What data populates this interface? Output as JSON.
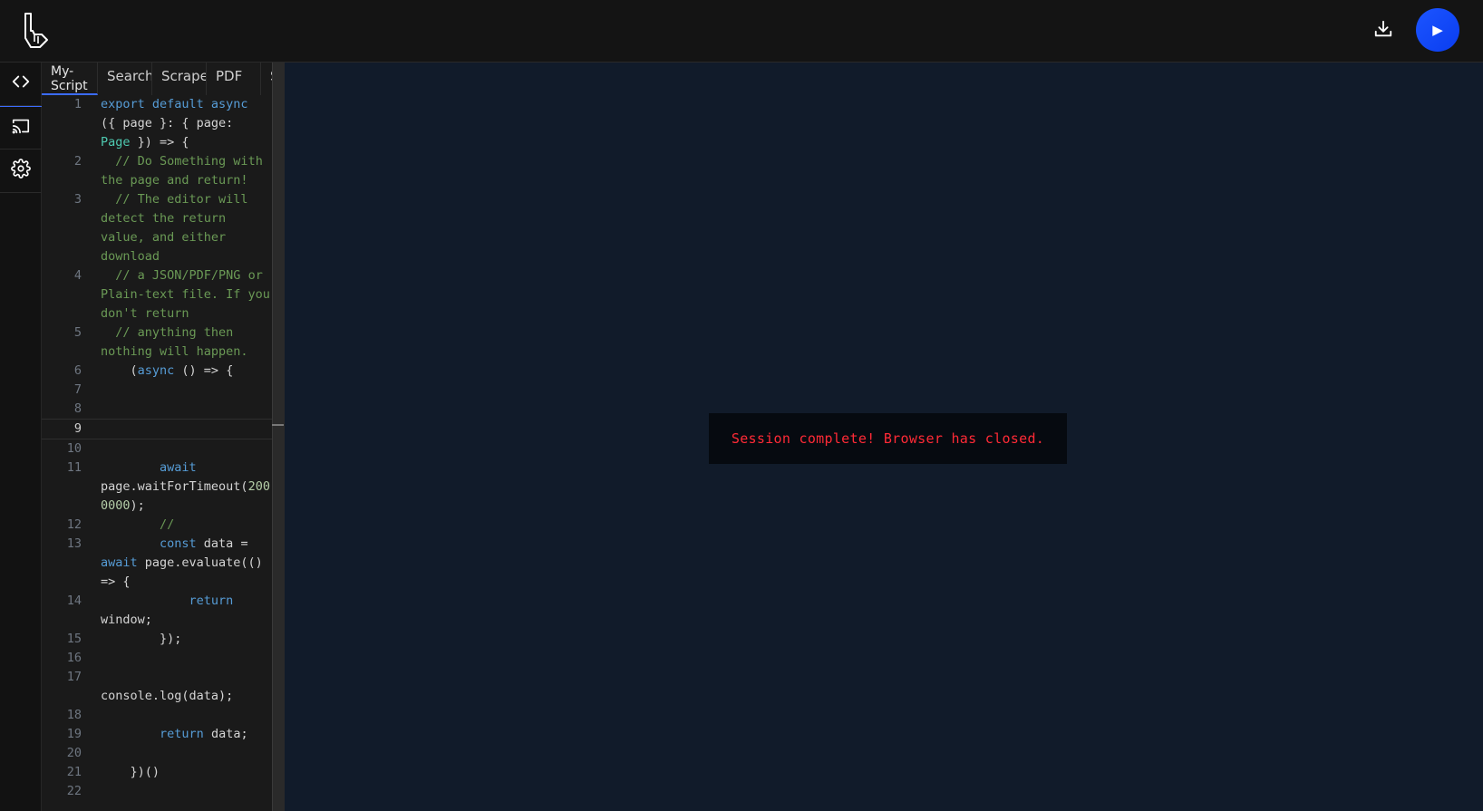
{
  "header": {
    "logo_icon": "pointer-hand-logo-icon",
    "download_icon": "download-icon",
    "run_label": "▶"
  },
  "sidebar": {
    "items": [
      {
        "icon": "code-icon"
      },
      {
        "icon": "cast-icon"
      },
      {
        "icon": "gear-icon"
      }
    ]
  },
  "editor": {
    "tabs": [
      {
        "label": "My-Script"
      },
      {
        "label": "Search"
      },
      {
        "label": "Scrape"
      },
      {
        "label": "PDF"
      },
      {
        "label": "Screenshot"
      }
    ],
    "current_line": 9,
    "lines": [
      {
        "n": "1"
      },
      {
        "n": "2"
      },
      {
        "n": "3"
      },
      {
        "n": "4"
      },
      {
        "n": "5"
      },
      {
        "n": "6"
      },
      {
        "n": "7"
      },
      {
        "n": "8"
      },
      {
        "n": "9"
      },
      {
        "n": "10"
      },
      {
        "n": "11"
      },
      {
        "n": "12"
      },
      {
        "n": "13"
      },
      {
        "n": "14"
      },
      {
        "n": "15"
      },
      {
        "n": "16"
      },
      {
        "n": "17"
      },
      {
        "n": "18"
      },
      {
        "n": "19"
      },
      {
        "n": "20"
      },
      {
        "n": "21"
      },
      {
        "n": "22"
      }
    ],
    "tokens": {
      "l1_a": "export default async",
      "l1_b": "({ page }: { page:",
      "l1_c": "Page",
      "l1_d": " }) => {",
      "l2": "  // Do Something with the page and return!",
      "l3": "  // The editor will detect the return value, and either download",
      "l4": "  // a JSON/PDF/PNG or Plain-text file. If you don't return",
      "l5": "  // anything then nothing will happen.",
      "l6_a": "    (",
      "l6_b": "async",
      "l6_c": " () => {",
      "l11_a": "        await",
      "l11_b": " page.waitForTimeout(",
      "l11_c": "2000000",
      "l11_d": ");",
      "l12": "        //",
      "l13_a": "        const",
      "l13_b": " data = ",
      "l13_c": "await",
      "l13_d": " page.evaluate(() => {",
      "l14_a": "            return",
      "l14_b": " window;",
      "l15": "        });",
      "l17": "        console.log(data);",
      "l19_a": "        return",
      "l19_b": " data;",
      "l21": "    })()"
    }
  },
  "viewer": {
    "toast": "Session complete! Browser has closed."
  },
  "colors": {
    "accent": "#1c55ff",
    "error_text": "#ff2a36",
    "viewer_bg": "#111b2a",
    "keyword": "#569cd6",
    "type": "#4ec9b0",
    "comment": "#6a9955",
    "number": "#b5cea8"
  }
}
